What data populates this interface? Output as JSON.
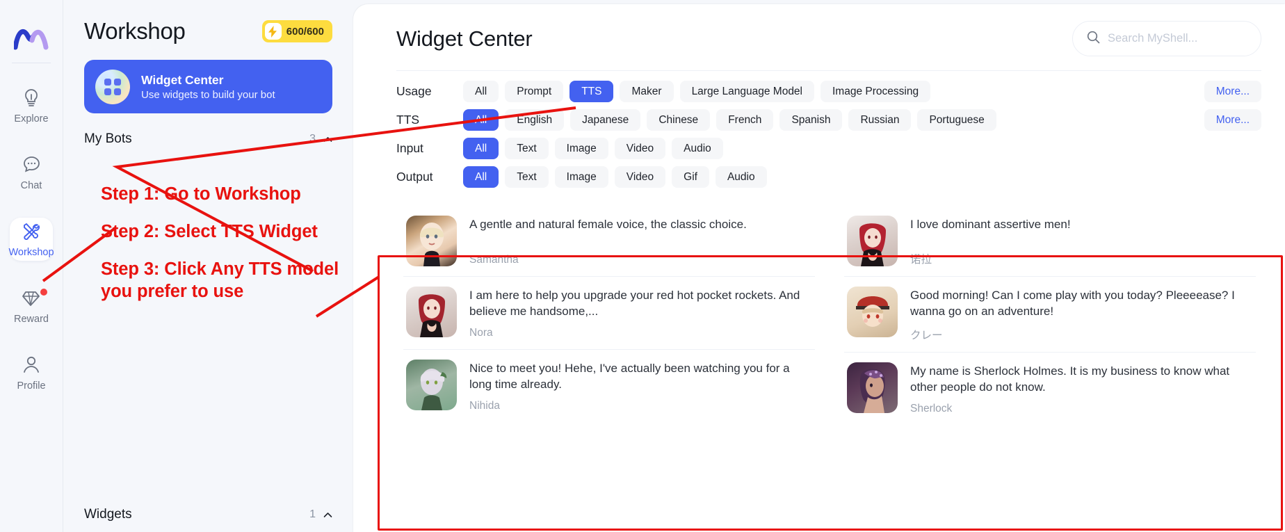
{
  "rail": {
    "logo_icon": "myshell-logo-icon",
    "items": [
      {
        "label": "Explore",
        "icon": "lightbulb-icon",
        "active": false,
        "dot": false
      },
      {
        "label": "Chat",
        "icon": "chat-bubble-icon",
        "active": false,
        "dot": false
      },
      {
        "label": "Workshop",
        "icon": "tools-icon",
        "active": true,
        "dot": false
      },
      {
        "label": "Reward",
        "icon": "diamond-icon",
        "active": false,
        "dot": true
      },
      {
        "label": "Profile",
        "icon": "user-icon",
        "active": false,
        "dot": false
      }
    ]
  },
  "left_panel": {
    "title": "Workshop",
    "credits": "600/600",
    "credits_icon": "bolt-icon",
    "widget_card": {
      "icon": "widget-grid-icon",
      "title": "Widget Center",
      "subtitle": "Use widgets to build your bot"
    },
    "sections": [
      {
        "name": "My Bots",
        "count": "3",
        "icon": "chevron-up-icon"
      },
      {
        "name": "Widgets",
        "count": "1",
        "icon": "chevron-up-icon"
      }
    ]
  },
  "main": {
    "page_title": "Widget Center",
    "search": {
      "icon": "search-icon",
      "placeholder": "Search MyShell...",
      "value": ""
    },
    "filters": [
      {
        "label": "Usage",
        "chips": [
          "All",
          "Prompt",
          "TTS",
          "Maker",
          "Large Language Model",
          "Image Processing"
        ],
        "active": "TTS",
        "more": "More..."
      },
      {
        "label": "TTS",
        "chips": [
          "All",
          "English",
          "Japanese",
          "Chinese",
          "French",
          "Spanish",
          "Russian",
          "Portuguese"
        ],
        "active": "All",
        "more": "More..."
      },
      {
        "label": "Input",
        "chips": [
          "All",
          "Text",
          "Image",
          "Video",
          "Audio"
        ],
        "active": "All",
        "more": ""
      },
      {
        "label": "Output",
        "chips": [
          "All",
          "Text",
          "Image",
          "Video",
          "Gif",
          "Audio"
        ],
        "active": "All",
        "more": ""
      }
    ],
    "results_left": [
      {
        "description": "A gentle and natural female voice, the classic choice.",
        "name": "Samantha",
        "thumb_colors": [
          "#8a6a4a",
          "#e8cfb2",
          "#2a1f18"
        ]
      },
      {
        "description": "I am here to help you upgrade your red hot pocket rockets. And believe me handsome,...",
        "name": "Nora",
        "thumb_colors": [
          "#e8e2e0",
          "#a3242e",
          "#1b1416"
        ]
      },
      {
        "description": "Nice to meet you! Hehe, I've actually been watching you for a long time already.",
        "name": "Nihida",
        "thumb_colors": [
          "#4b6b54",
          "#d8d4dd",
          "#7fa08a"
        ]
      }
    ],
    "results_right": [
      {
        "description": "I love dominant assertive men!",
        "name": "诺拉",
        "thumb_colors": [
          "#ece6e4",
          "#b32230",
          "#1c1417"
        ]
      },
      {
        "description": "Good morning! Can I come play with you today? Pleeeease? I wanna go on an adventure!",
        "name": "クレー",
        "thumb_colors": [
          "#e8d9c3",
          "#b53128",
          "#d9b98f"
        ]
      },
      {
        "description": "My name is Sherlock Holmes. It is my business to know what other people do not know.",
        "name": "Sherlock",
        "thumb_colors": [
          "#3b2440",
          "#caa08c",
          "#6e4a63"
        ]
      }
    ]
  },
  "annotations": {
    "color": "#e8120f",
    "steps": [
      "Step 1: Go to Workshop",
      "Step 2: Select TTS Widget",
      "Step 3: Click Any TTS model\nyou prefer to use"
    ]
  }
}
